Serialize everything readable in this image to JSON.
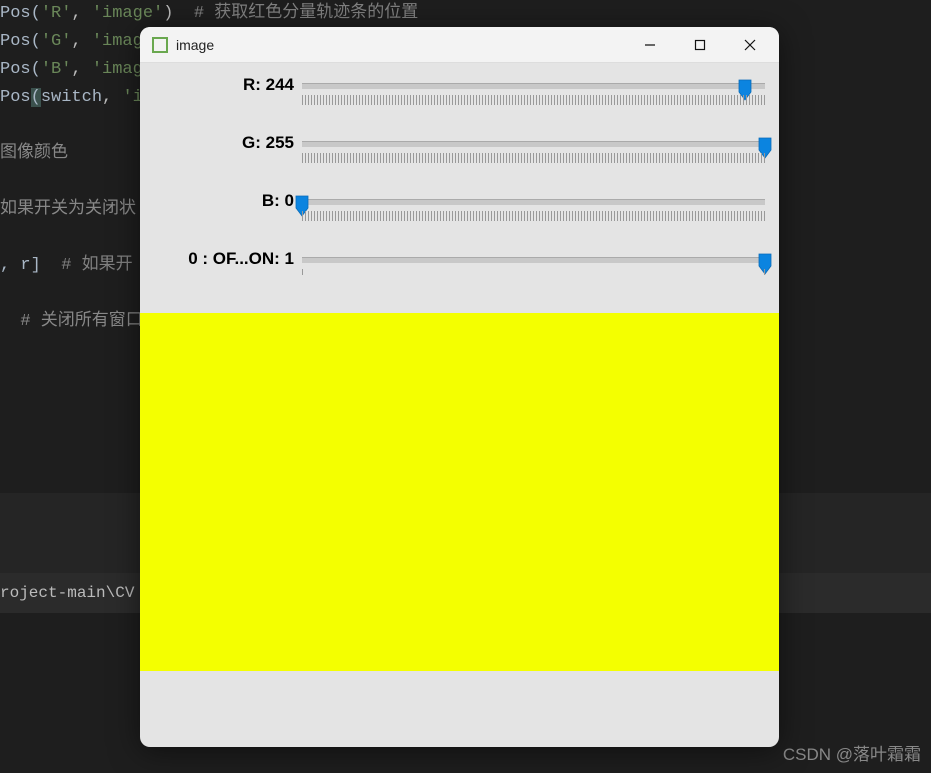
{
  "code": {
    "lines": [
      {
        "prefix": "​Pos(",
        "arg1": "'R'",
        "sep": ", ",
        "arg2": "'image'",
        "suffix": ")",
        "comment": "  # 获取红色分量轨迹条的位置"
      },
      {
        "prefix": "​Pos(",
        "arg1": "'G'",
        "sep": ", ",
        "arg2": "'imag",
        "suffix": "",
        "comment": ""
      },
      {
        "prefix": "​Pos(",
        "arg1": "'B'",
        "sep": ", ",
        "arg2": "'imag",
        "suffix": "",
        "comment": ""
      },
      {
        "prefix": "​Pos(",
        "arg1": "switch",
        "sep": ", ",
        "arg2": "'i",
        "suffix": "",
        "comment": "",
        "is_ident": true,
        "bracket_hl": true
      }
    ],
    "frag1": "图像颜色",
    "frag2": "如果开关为关闭状",
    "frag3_pre": ", r]",
    "frag3_comment": "  # 如果开",
    "frag4": "  # 关闭所有窗口"
  },
  "terminal": {
    "path": "roject-main\\CV"
  },
  "watermark": "CSDN @落叶霜霜",
  "window": {
    "title": "image",
    "trackbars": [
      {
        "label": "R: 244",
        "value": 244,
        "max": 255,
        "ticks": "dense"
      },
      {
        "label": "G: 255",
        "value": 255,
        "max": 255,
        "ticks": "dense"
      },
      {
        "label": "B: 0",
        "value": 0,
        "max": 255,
        "ticks": "dense"
      },
      {
        "label": "0 : OF...ON: 1",
        "value": 1,
        "max": 1,
        "ticks": "minimal"
      }
    ],
    "output_color": "#f4ff00"
  }
}
